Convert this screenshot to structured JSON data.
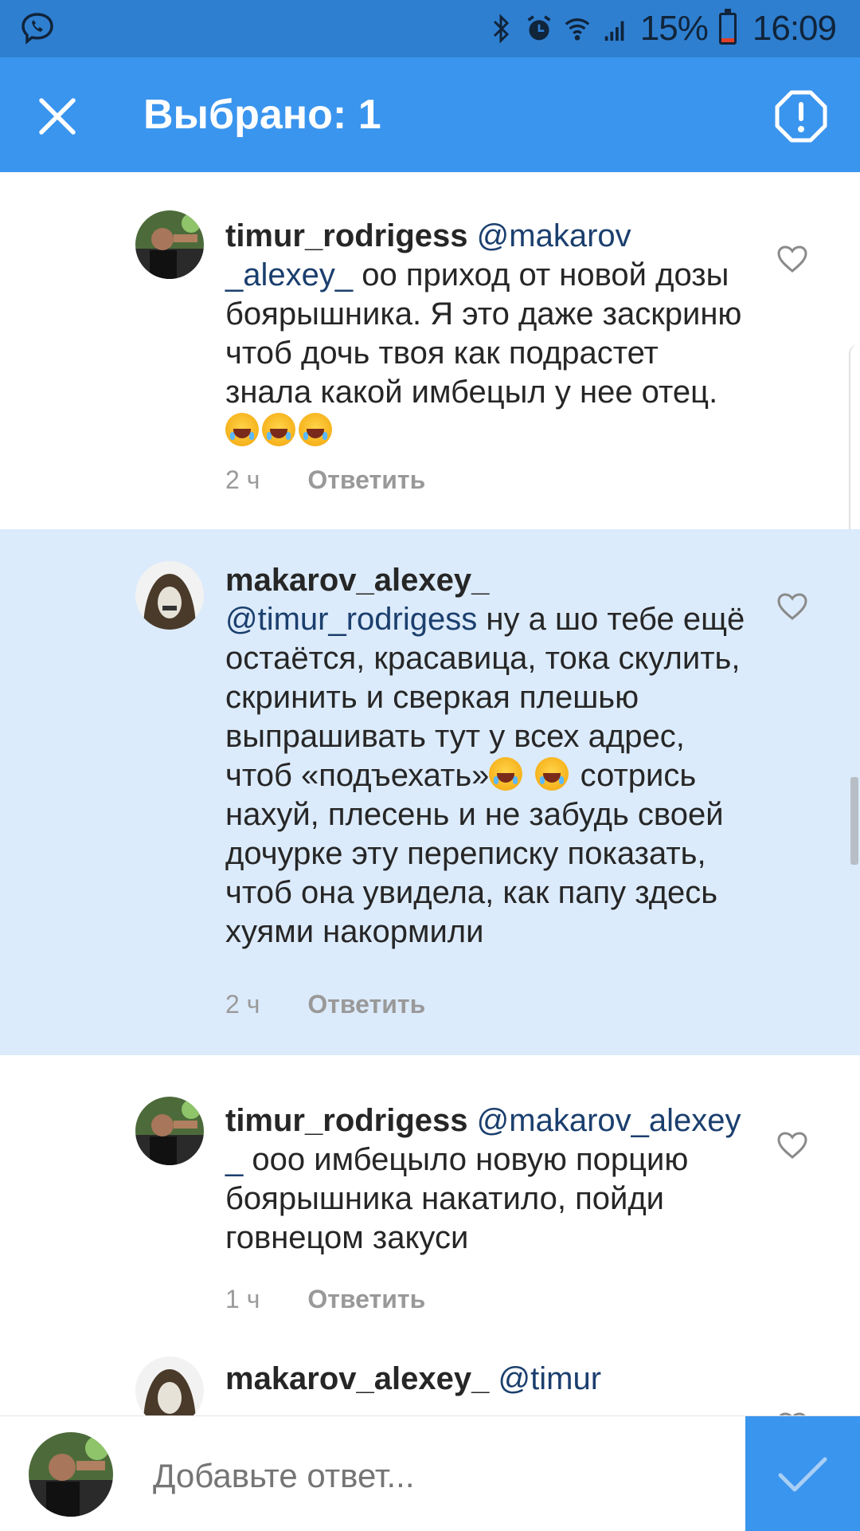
{
  "status_bar": {
    "battery_percent": "15%",
    "battery_level": 0.15,
    "time": "16:09"
  },
  "app_bar": {
    "title": "Выбрано: 1"
  },
  "comments": [
    {
      "user": "timur_rodrigess",
      "mention": "@makarov _alexey_",
      "text": "оо приход от новой дозы боярышника. Я это даже заскриню чтоб дочь твоя как подрастет знала какой имбецыл у нее отец.",
      "emoji": [
        "rofl-emoji",
        "rofl-emoji",
        "rofl-emoji"
      ],
      "time": "2 ч",
      "reply_label": "Ответить",
      "selected": false
    },
    {
      "user": "makarov_alexey_",
      "mention": "@timur_rodrigess",
      "text_a": "ну а шо тебе ещё остаётся, красавица, тока скулить, скринить и сверкая плешью выпрашивать тут у всех адрес, чтоб «подъехать»",
      "text_b": "сотрись нахуй, плесень и не забудь своей дочурке эту переписку показать, чтоб она увидела, как папу здесь хуями накормили",
      "emoji": [
        "joy-emoji",
        "joy-emoji"
      ],
      "time": "2 ч",
      "reply_label": "Ответить",
      "selected": true
    },
    {
      "user": "timur_rodrigess",
      "mention": "@makarov_alexey _",
      "text": "ооо имбецыло  новую порцию боярышника накатило,  пойди говнецом закуси",
      "time": "1 ч",
      "reply_label": "Ответить",
      "selected": false
    },
    {
      "user": "makarov_alexey_",
      "mention": "@timur",
      "text": "",
      "selected": false
    }
  ],
  "composer": {
    "placeholder": "Добавьте ответ..."
  },
  "colors": {
    "status_bar": "#2f7fd0",
    "app_bar": "#3a95ee",
    "selected_bg": "#dcebfb",
    "mention": "#1b3f6e"
  }
}
